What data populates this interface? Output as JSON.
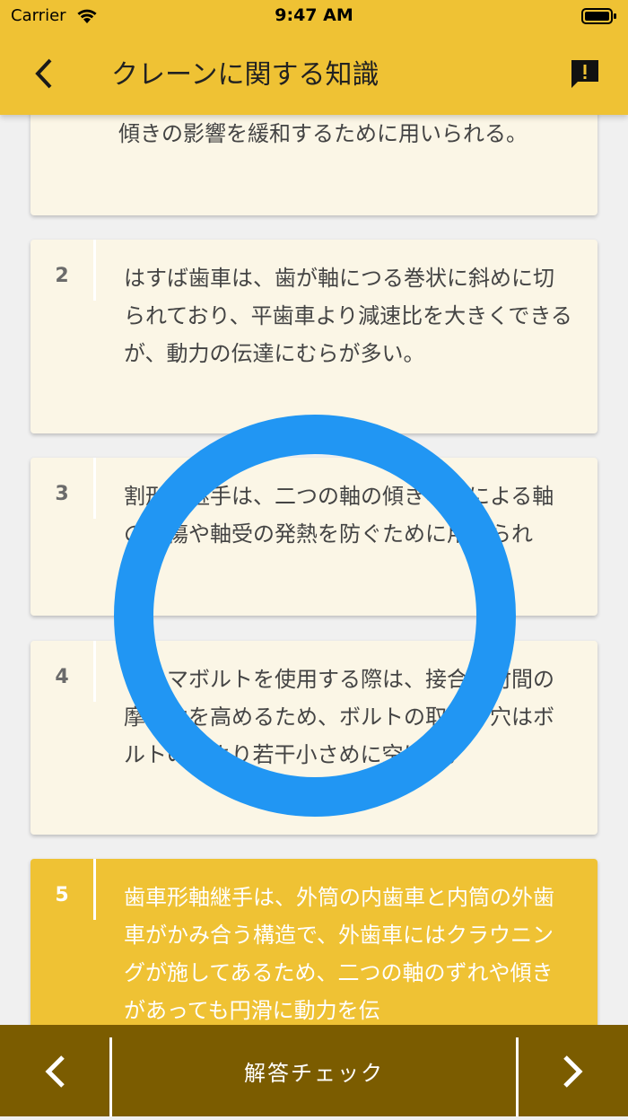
{
  "status_bar": {
    "carrier": "Carrier",
    "time": "9:47 AM"
  },
  "header": {
    "title": "クレーンに関する知識"
  },
  "choices": [
    {
      "number": "",
      "text": "傾きの影響を緩和するために用いられる。"
    },
    {
      "number": "2",
      "text": "はすば歯車は、歯が軸につる巻状に斜めに切られており、平歯車より減速比を大きくできるが、動力の伝達にむらが多い。"
    },
    {
      "number": "3",
      "text": "割形軸継手は、二つの軸の傾きなどによる軸の損傷や軸受の発熱を防ぐために用いられる。"
    },
    {
      "number": "4",
      "text": "リーマボルトを使用する際は、接合部材間の摩擦力を高めるため、ボルトの取付け穴はボルトの径より若干小さめに空ける。"
    },
    {
      "number": "5",
      "text": "歯車形軸継手は、外筒の内歯車と内筒の外歯車がかみ合う構造で、外歯車にはクラウニングが施してあるため、二つの軸のずれや傾きがあっても円滑に動力を伝"
    }
  ],
  "overlay": {
    "mark": "correct",
    "color": "#2196f3"
  },
  "footer": {
    "check_label": "解答チェック"
  },
  "colors": {
    "accent": "#efc234",
    "footer": "#7b5c00",
    "card": "#fbf6e6"
  }
}
